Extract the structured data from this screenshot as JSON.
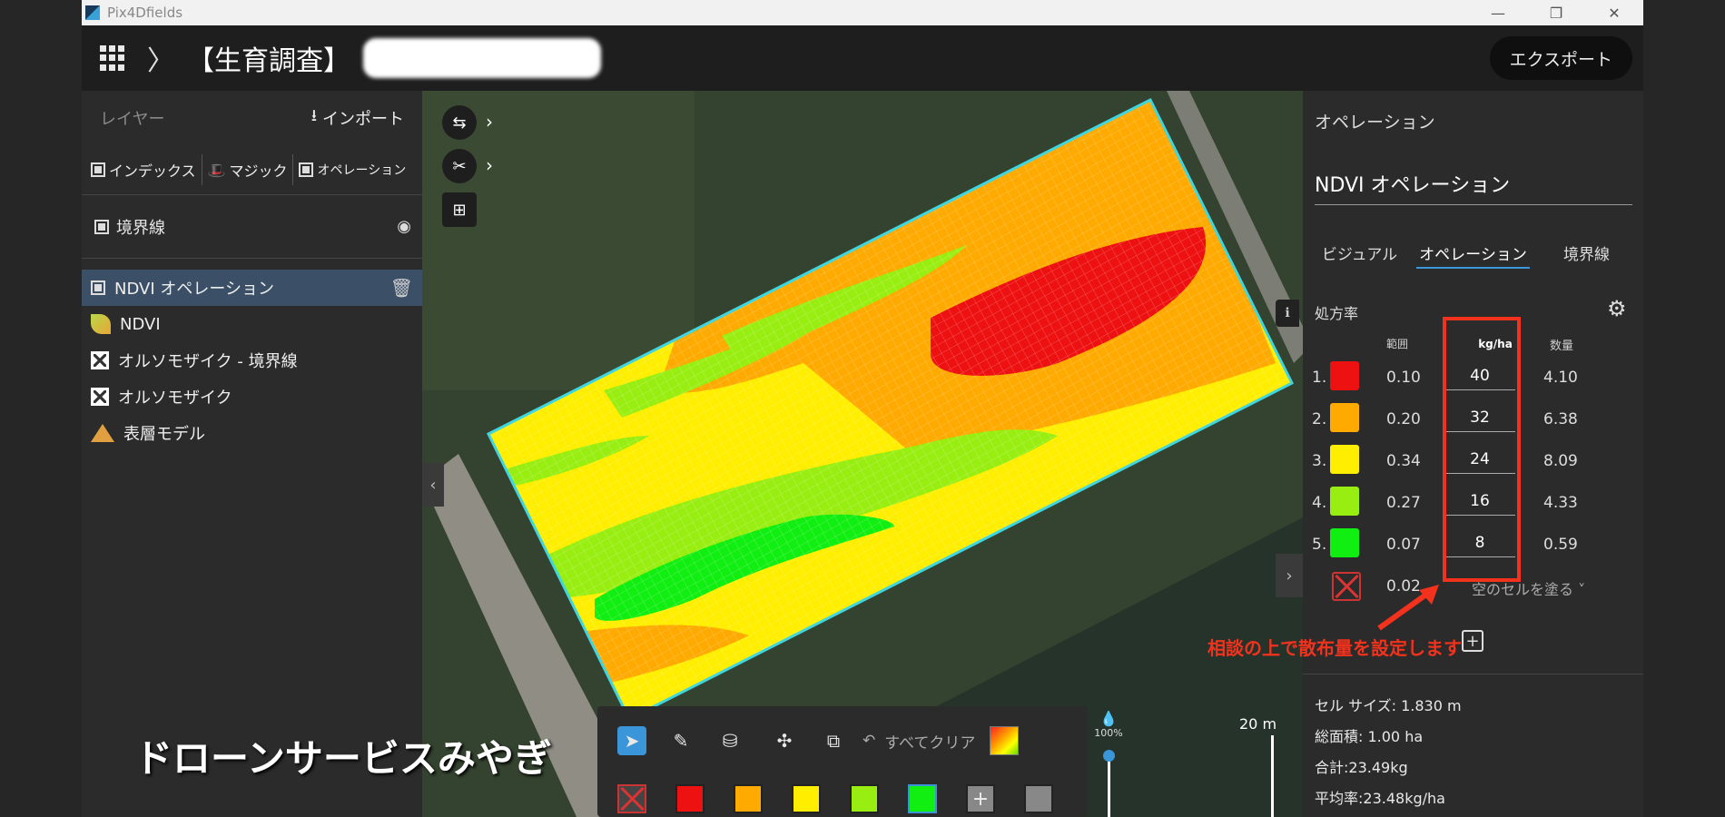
{
  "window": {
    "title": "Pix4Dfields",
    "minimize_glyph": "—",
    "maximize_glyph": "❐",
    "close_glyph": "✕"
  },
  "header": {
    "chevron_glyph": "〉",
    "project_title": "【生育調査】",
    "export_label": "エクスポート"
  },
  "left_panel": {
    "layer_label": "レイヤー",
    "import_label": "インポート",
    "import_glyph": "⭳",
    "tools": [
      {
        "label": "インデックス",
        "icon": "index-icon"
      },
      {
        "label": "マジック",
        "icon": "magic-icon"
      },
      {
        "label": "オペレーション",
        "icon": "operation-icon"
      }
    ],
    "magic_glyph": "🎩",
    "boundary_label": "境界線",
    "eye_glyph": "◉",
    "trash_glyph": "🗑",
    "layers": [
      {
        "label": "NDVI オペレーション",
        "icon": "operation-icon",
        "selected": true
      },
      {
        "label": "NDVI",
        "icon": "leaf-icon",
        "selected": false
      },
      {
        "label": "オルソモザイク - 境界線",
        "icon": "orthomosaic-icon",
        "selected": false
      },
      {
        "label": "オルソモザイク",
        "icon": "orthomosaic-icon",
        "selected": false
      },
      {
        "label": "表層モデル",
        "icon": "surface-model-icon",
        "selected": false
      }
    ],
    "collapse_glyph": "‹"
  },
  "watermark": "ドローンサービスみやぎ",
  "map": {
    "tool_arrow_glyph": "›",
    "info_glyph": "ℹ",
    "expand_glyph": "›",
    "scale_label": "20 m"
  },
  "draw_toolbar": {
    "clear_label": "すべてクリア",
    "undo_glyph": "↶",
    "select_glyph": "➤",
    "brush_glyph": "✎",
    "fill_glyph": "⛁",
    "magic_glyph": "✣",
    "crop_glyph": "⧉",
    "plus_glyph": "+",
    "swatches": [
      "#ee1111",
      "#ffaa00",
      "#ffee00",
      "#99ee11",
      "#11ee11"
    ],
    "extra_swatch": "#888888",
    "opacity_label": "100%",
    "opacity_glyph": "💧"
  },
  "right_panel": {
    "title": "オペレーション",
    "operation_name": "NDVI オペレーション",
    "tabs": [
      {
        "label": "ビジュアル",
        "active": false
      },
      {
        "label": "オペレーション",
        "active": true
      },
      {
        "label": "境界線",
        "active": false
      }
    ],
    "rate_label": "処方率",
    "gear_glyph": "⚙",
    "col_range": "範囲",
    "col_unit": "kg/ha",
    "col_quantity": "数量",
    "classes": [
      {
        "index": "1.",
        "color": "#ee1111",
        "range": "0.10",
        "rate": "40",
        "quantity": "4.10"
      },
      {
        "index": "2.",
        "color": "#ffaa00",
        "range": "0.20",
        "rate": "32",
        "quantity": "6.38"
      },
      {
        "index": "3.",
        "color": "#ffee00",
        "range": "0.34",
        "rate": "24",
        "quantity": "8.09"
      },
      {
        "index": "4.",
        "color": "#99ee11",
        "range": "0.27",
        "rate": "16",
        "quantity": "4.33"
      },
      {
        "index": "5.",
        "color": "#11ee11",
        "range": "0.07",
        "rate": "8",
        "quantity": "0.59"
      }
    ],
    "empty_range": "0.02",
    "empty_fill_label": "空のセルを塗る ˅",
    "add_glyph": "+",
    "stats": {
      "cell_size": "セル サイズ: 1.830 m",
      "total_area": "総面積: 1.00 ha",
      "total": "合計:23.49kg",
      "average": "平均率:23.48kg/ha"
    }
  },
  "annotation": {
    "text": "相談の上で散布量を設定します",
    "color": "#f2321c"
  },
  "colors": {
    "accent": "#3a96d8",
    "selected_layer": "#3b4f66"
  }
}
